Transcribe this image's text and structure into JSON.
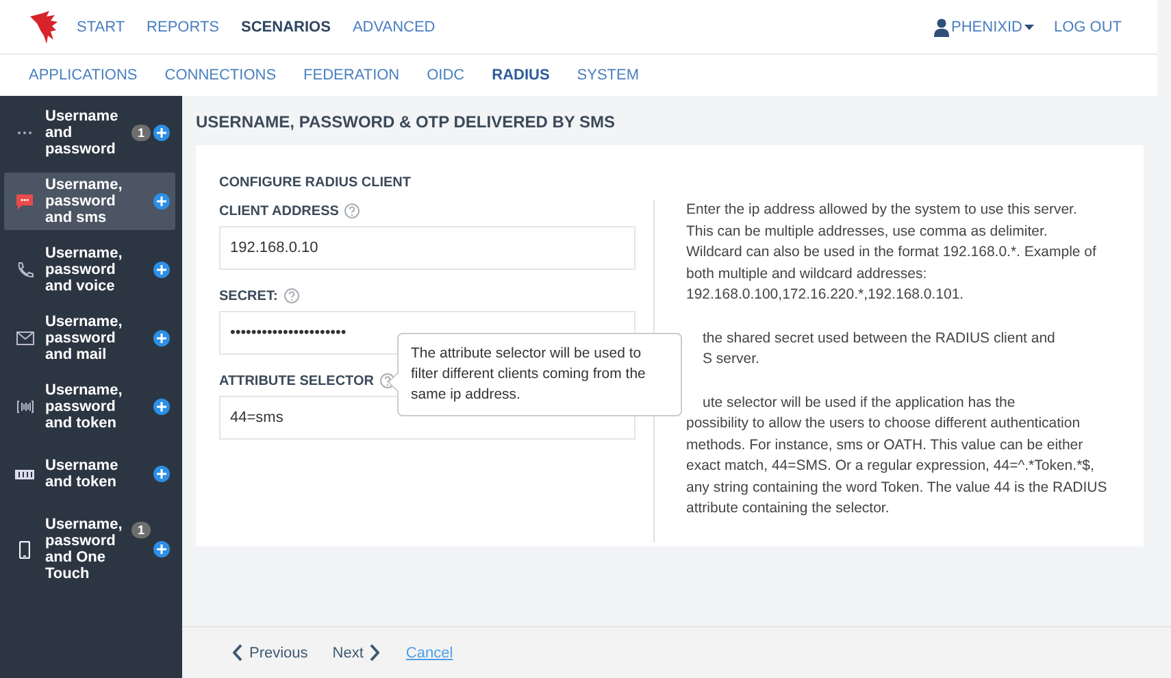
{
  "top_nav": {
    "items": [
      {
        "label": "START",
        "selected": false
      },
      {
        "label": "REPORTS",
        "selected": false
      },
      {
        "label": "SCENARIOS",
        "selected": true
      },
      {
        "label": "ADVANCED",
        "selected": false
      }
    ],
    "user": "PHENIXID",
    "logout": "LOG OUT"
  },
  "sub_nav": [
    {
      "label": "APPLICATIONS",
      "selected": false
    },
    {
      "label": "CONNECTIONS",
      "selected": false
    },
    {
      "label": "FEDERATION",
      "selected": false
    },
    {
      "label": "OIDC",
      "selected": false
    },
    {
      "label": "RADIUS",
      "selected": true
    },
    {
      "label": "SYSTEM",
      "selected": false
    }
  ],
  "sidebar": {
    "items": [
      {
        "kind": "dots",
        "label": "Username and password",
        "badge": "1",
        "selected": false
      },
      {
        "kind": "sms",
        "label": "Username, password and sms",
        "selected": true
      },
      {
        "kind": "voice",
        "label": "Username, password and voice",
        "selected": false
      },
      {
        "kind": "mail",
        "label": "Username, password and mail",
        "selected": false
      },
      {
        "kind": "token",
        "label": "Username, password and token",
        "selected": false
      },
      {
        "kind": "card",
        "label": "Username and token",
        "selected": false
      },
      {
        "kind": "phone",
        "label": "Username, password and One Touch",
        "badge": "1",
        "selected": false
      }
    ]
  },
  "page_title": "USERNAME, PASSWORD & OTP DELIVERED BY SMS",
  "card": {
    "title": "CONFIGURE RADIUS CLIENT",
    "fields": [
      {
        "label": "CLIENT ADDRESS",
        "value": "192.168.0.10"
      },
      {
        "label": "SECRET:",
        "value": "••••••••••••••••••••••"
      },
      {
        "label": "ATTRIBUTE SELECTOR",
        "value": "44=sms"
      }
    ],
    "help": [
      {
        "lines": [
          {
            "kind": "full",
            "text": "Enter the ip address allowed by the system to use this server."
          },
          {
            "kind": "full",
            "text": "This can be multiple addresses, use comma as delimiter."
          },
          {
            "kind": "full",
            "text": "Wildcard can also be used in the format 192.168.0.*. Example of"
          },
          {
            "kind": "full",
            "text": "both multiple and wildcard addresses:"
          },
          {
            "kind": "full",
            "text": "192.168.0.100,172.16.220.*,192.168.0.101."
          }
        ]
      },
      {
        "lines": [
          {
            "kind": "clipped",
            "text": "the shared secret used between the RADIUS client and"
          },
          {
            "kind": "clipped",
            "text": "S server."
          }
        ]
      },
      {
        "lines": [
          {
            "kind": "clipped",
            "text": "ute selector will be used if the application has the"
          },
          {
            "kind": "full",
            "text": "possibility to allow the users to choose different authentication"
          },
          {
            "kind": "full",
            "text": "methods. For instance, sms or OATH. This value can be either"
          },
          {
            "kind": "full",
            "text": "exact match, 44=SMS. Or a regular expression, 44=^.*Token.*$,"
          },
          {
            "kind": "full",
            "text": "any string containing the word Token. The value 44 is the RADIUS"
          },
          {
            "kind": "full",
            "text": "attribute containing the selector."
          }
        ]
      }
    ],
    "tooltip": "The attribute selector will be used to filter different clients coming from the same ip address."
  },
  "footer": {
    "previous": "Previous",
    "next": "Next",
    "cancel": "Cancel"
  }
}
